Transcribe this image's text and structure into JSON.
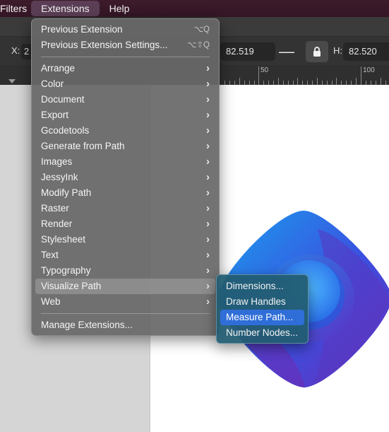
{
  "menubar": {
    "items": [
      {
        "label": "Filters"
      },
      {
        "label": "Extensions"
      },
      {
        "label": "Help"
      }
    ]
  },
  "toolbar": {
    "x_label": "X:",
    "x_value": "2",
    "w_value": "82.519",
    "minus_plus": "—+",
    "h_label": "H:",
    "h_value": "82.520"
  },
  "ruler": {
    "labels": [
      "50",
      "100"
    ]
  },
  "extensions_menu": {
    "top_items": [
      {
        "label": "Previous Extension",
        "shortcut": "⌥Q"
      },
      {
        "label": "Previous Extension Settings...",
        "shortcut": "⌥⇧Q"
      }
    ],
    "submenus": [
      {
        "label": "Arrange"
      },
      {
        "label": "Color"
      },
      {
        "label": "Document"
      },
      {
        "label": "Export"
      },
      {
        "label": "Gcodetools"
      },
      {
        "label": "Generate from Path"
      },
      {
        "label": "Images"
      },
      {
        "label": "JessyInk"
      },
      {
        "label": "Modify Path"
      },
      {
        "label": "Raster"
      },
      {
        "label": "Render"
      },
      {
        "label": "Stylesheet"
      },
      {
        "label": "Text"
      },
      {
        "label": "Typography"
      },
      {
        "label": "Visualize Path"
      },
      {
        "label": "Web"
      }
    ],
    "arrow": "›",
    "manage": "Manage Extensions..."
  },
  "visualize_path_submenu": {
    "items": [
      {
        "label": "Dimensions..."
      },
      {
        "label": "Draw Handles"
      },
      {
        "label": "Measure Path..."
      },
      {
        "label": "Number Nodes..."
      }
    ],
    "selected": "Measure Path..."
  },
  "colors": {
    "menubar_bg": "#3d1b2a",
    "submenu_bg": "#225c72",
    "selection": "#2f6ed8"
  }
}
